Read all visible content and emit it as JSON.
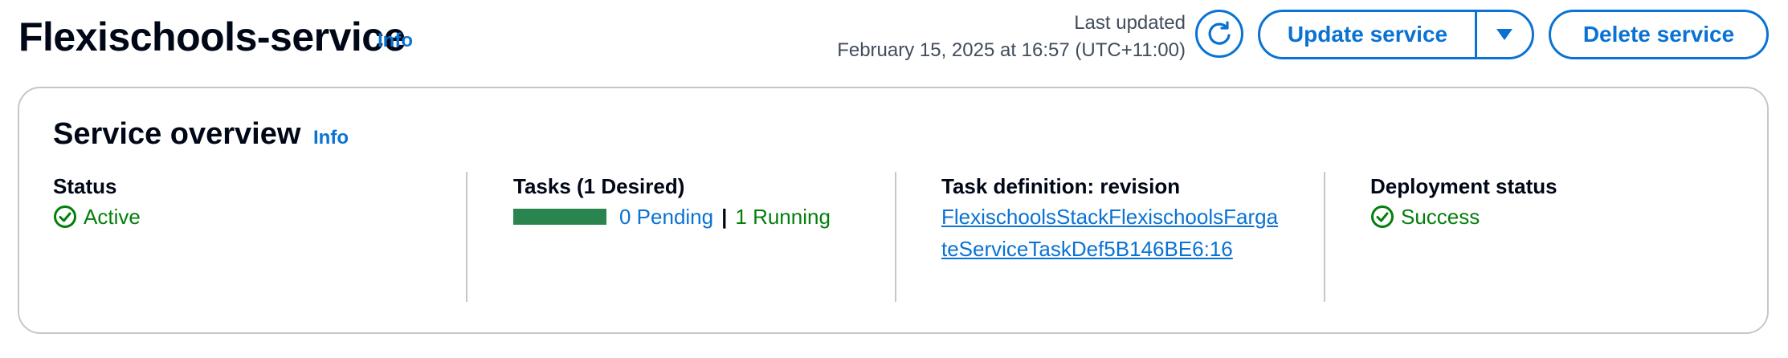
{
  "header": {
    "title": "Flexischools-service",
    "info_label": "Info",
    "last_updated_label": "Last updated",
    "last_updated_value": "February 15, 2025 at 16:57 (UTC+11:00)",
    "refresh_icon": "refresh-icon",
    "update_button_label": "Update service",
    "update_dropdown_icon": "caret-down-icon",
    "delete_button_label": "Delete service"
  },
  "overview": {
    "title": "Service overview",
    "info_label": "Info",
    "status": {
      "label": "Status",
      "value": "Active",
      "icon": "check-circle-icon"
    },
    "tasks": {
      "label": "Tasks (1 Desired)",
      "pending": "0 Pending",
      "separator": "|",
      "running": "1 Running",
      "progress_fraction": 1.0
    },
    "task_definition": {
      "label": "Task definition: revision",
      "value": "FlexischoolsStackFlexischoolsFargateServiceTaskDef5B146BE6:16"
    },
    "deployment": {
      "label": "Deployment status",
      "value": "Success",
      "icon": "check-circle-icon"
    }
  },
  "colors": {
    "accent": "#0972d3",
    "success": "#037f0c",
    "bar": "#29844e",
    "border": "#c6c6cd"
  }
}
